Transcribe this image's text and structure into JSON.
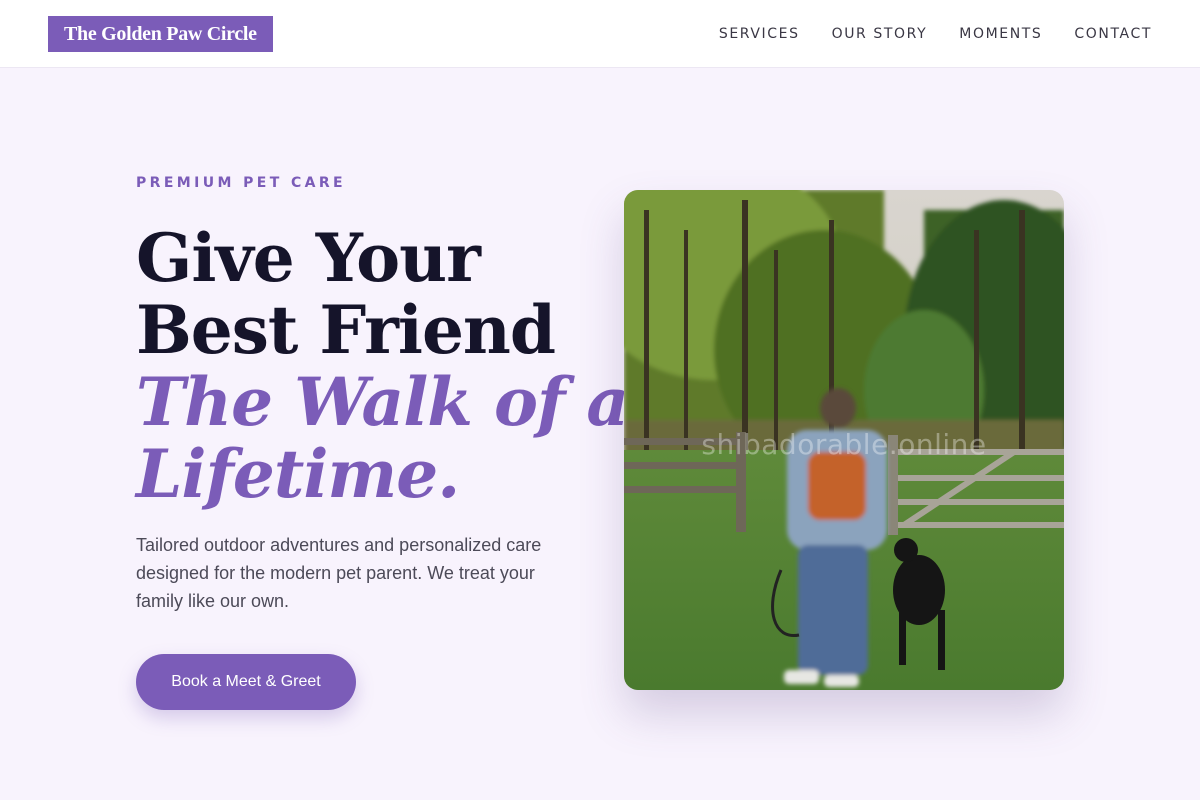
{
  "brand": {
    "name": "The Golden Paw Circle"
  },
  "nav": {
    "items": [
      {
        "label": "SERVICES"
      },
      {
        "label": "OUR STORY"
      },
      {
        "label": "MOMENTS"
      },
      {
        "label": "CONTACT"
      }
    ]
  },
  "hero": {
    "eyebrow": "PREMIUM PET CARE",
    "headline_line1": "Give Your",
    "headline_line2": "Best Friend",
    "headline_accent_line1": "The Walk of a",
    "headline_accent_line2": "Lifetime.",
    "description": "Tailored outdoor adventures and personalized care designed for the modern pet parent. We treat your family like our own.",
    "cta_label": "Book a Meet & Greet",
    "image_watermark": "shibadorable.online"
  },
  "colors": {
    "accent": "#7b5cb8",
    "background": "#f8f3fd",
    "headline": "#15142a"
  }
}
